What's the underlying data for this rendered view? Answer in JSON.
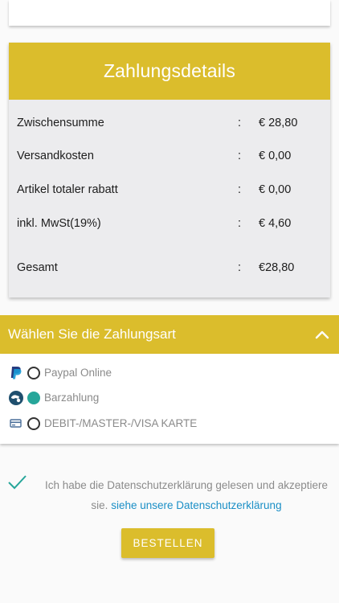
{
  "payment_details": {
    "title": "Zahlungsdetails",
    "rows": [
      {
        "label": "Zwischensumme",
        "sep": ":",
        "value": "€ 28,80"
      },
      {
        "label": "Versandkosten",
        "sep": ":",
        "value": "€ 0,00"
      },
      {
        "label": "Artikel totaler rabatt",
        "sep": ":",
        "value": "€ 0,00"
      },
      {
        "label": "inkl. MwSt(19%)",
        "sep": ":",
        "value": "€ 4,60"
      },
      {
        "label": "Gesamt",
        "sep": ":",
        "value": "€28,80"
      }
    ]
  },
  "payment_method": {
    "title": "Wählen Sie die Zahlungsart",
    "options": [
      {
        "label": "Paypal Online",
        "icon": "paypal-icon",
        "selected": false
      },
      {
        "label": "Barzahlung",
        "icon": "cash-icon",
        "selected": true
      },
      {
        "label": "DEBIT-/MASTER-/VISA KARTE",
        "icon": "card-icon",
        "selected": false
      }
    ]
  },
  "consent": {
    "text": "Ich habe die Datenschutzerklärung gelesen und akzeptiere sie.",
    "link": "siehe unsere Datenschutzerklärung"
  },
  "order_button": "BESTELLEN",
  "colors": {
    "accent": "#dbbd2c",
    "radio_selected": "#26a69a",
    "link": "#1b8fc6"
  }
}
